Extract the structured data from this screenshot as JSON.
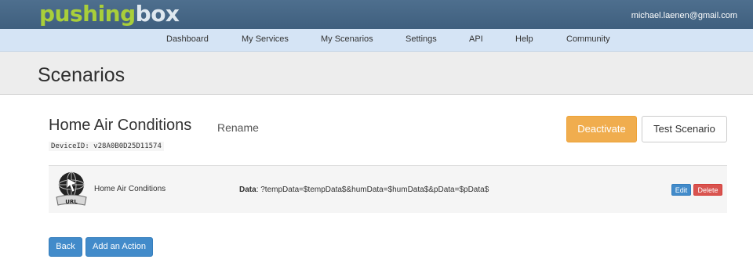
{
  "header": {
    "logo_part1": "pushing",
    "logo_part2": "box",
    "user_email": "michael.laenen@gmail.com"
  },
  "nav": {
    "items": [
      "Dashboard",
      "My Services",
      "My Scenarios",
      "Settings",
      "API",
      "Help",
      "Community"
    ]
  },
  "page": {
    "title": "Scenarios"
  },
  "scenario": {
    "name": "Home Air Conditions",
    "rename_label": "Rename",
    "device_id": "DeviceID: v28A0B0D25D11574",
    "deactivate_label": "Deactivate",
    "test_label": "Test Scenario"
  },
  "action": {
    "icon_label": "URL",
    "name": "Home Air Conditions",
    "data_label": "Data",
    "data_value": ": ?tempData=$tempData$&humData=$humData$&pData=$pData$",
    "edit_label": "Edit",
    "delete_label": "Delete"
  },
  "footer": {
    "back_label": "Back",
    "add_action_label": "Add an Action"
  },
  "colors": {
    "header_bg": "#4e6f8e",
    "nav_bg": "#d5e4f5",
    "logo_green": "#a9cf3a",
    "warning": "#f0ad4e",
    "primary": "#428bca",
    "danger": "#d9534f"
  }
}
